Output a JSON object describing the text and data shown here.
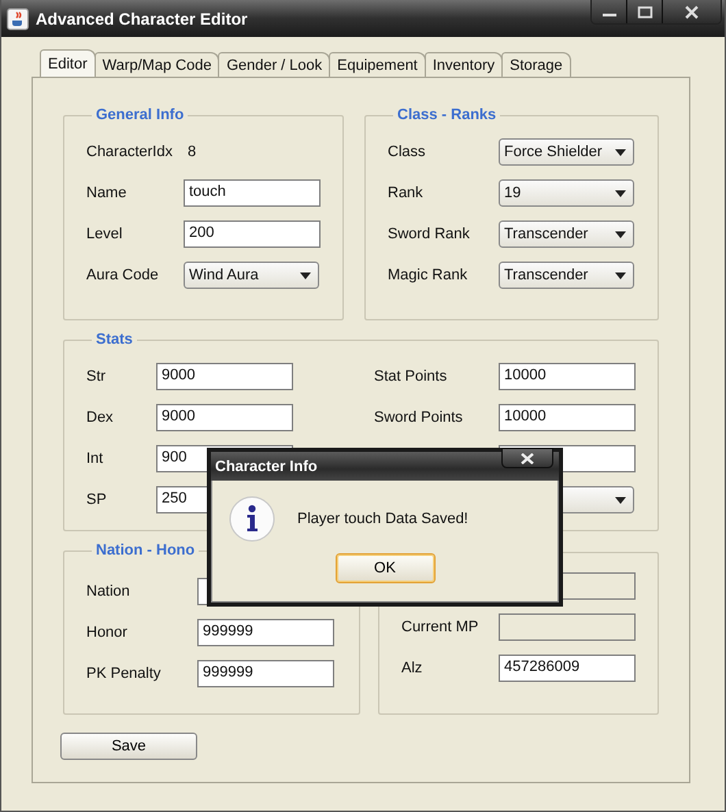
{
  "window": {
    "title": "Advanced Character Editor"
  },
  "tabs": [
    {
      "label": "Editor",
      "selected": true
    },
    {
      "label": "Warp/Map Code",
      "selected": false
    },
    {
      "label": "Gender / Look",
      "selected": false
    },
    {
      "label": "Equipement",
      "selected": false
    },
    {
      "label": "Inventory",
      "selected": false
    },
    {
      "label": "Storage",
      "selected": false
    }
  ],
  "general_info": {
    "title": "General Info",
    "rows": [
      {
        "kind": "text",
        "label": "CharacterIdx",
        "value": "8"
      },
      {
        "kind": "field",
        "label": "Name",
        "value": "touch"
      },
      {
        "kind": "field",
        "label": "Level",
        "value": "200"
      },
      {
        "kind": "dropdown",
        "label": "Aura Code",
        "value": "Wind Aura"
      }
    ]
  },
  "class_ranks": {
    "title": "Class - Ranks",
    "rows": [
      {
        "kind": "dropdown",
        "label": "Class",
        "value": "Force Shielder"
      },
      {
        "kind": "dropdown",
        "label": "Rank",
        "value": "19"
      },
      {
        "kind": "dropdown",
        "label": "Sword Rank",
        "value": "Transcender"
      },
      {
        "kind": "dropdown",
        "label": "Magic Rank",
        "value": "Transcender"
      }
    ]
  },
  "stats": {
    "title": "Stats",
    "rows": [
      {
        "kind": "field",
        "label": "Str",
        "value": "9000"
      },
      {
        "kind": "field",
        "label": "Stat Points",
        "value": "10000"
      },
      {
        "kind": "field",
        "label": "Dex",
        "value": "9000"
      },
      {
        "kind": "field",
        "label": "Sword Points",
        "value": "10000"
      },
      {
        "kind": "field",
        "label": "Int",
        "value": "900"
      },
      {
        "kind": "field"
      },
      {
        "kind": "field",
        "label": "SP",
        "value": "250"
      },
      {
        "kind": "dropdown"
      }
    ]
  },
  "nation_honor": {
    "title": "Nation - Hono",
    "rows": [
      {
        "kind": "field",
        "label": "Nation"
      },
      {
        "kind": "field",
        "label": "Honor",
        "value": "999999"
      },
      {
        "kind": "field",
        "label": "PK Penalty",
        "value": "999999"
      }
    ]
  },
  "status_group": {
    "rows": [
      {
        "kind": "field",
        "disabled": true
      },
      {
        "kind": "field",
        "label": "Current MP",
        "disabled": true
      },
      {
        "kind": "field",
        "label": "Alz",
        "value": "457286009",
        "disabled": false
      }
    ]
  },
  "save_button": "Save",
  "dialog": {
    "title": "Character Info",
    "message": "Player touch Data Saved!",
    "button": "OK"
  }
}
